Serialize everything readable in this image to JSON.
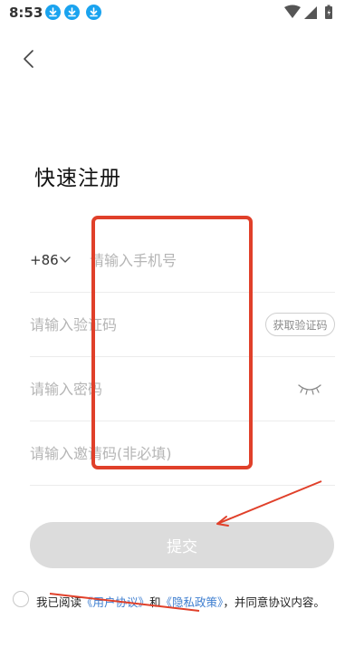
{
  "status_bar": {
    "time": "8:53"
  },
  "header": {
    "title": "快速注册"
  },
  "form": {
    "country_code": "+86",
    "phone_placeholder": "请输入手机号",
    "code_placeholder": "请输入验证码",
    "get_code_label": "获取验证码",
    "password_placeholder": "请输入密码",
    "invite_placeholder": "请输入邀请码(非必填)",
    "submit_label": "提交"
  },
  "agreement": {
    "prefix": "我已阅读",
    "user_agreement": "《用户协议》",
    "and": "和",
    "privacy_policy": "《隐私政策》",
    "suffix": "，并同意协议内容。"
  },
  "colors": {
    "accent_link": "#3f7fd0",
    "submit_disabled": "#dcdcdc",
    "annotation_red": "#e0402a"
  }
}
